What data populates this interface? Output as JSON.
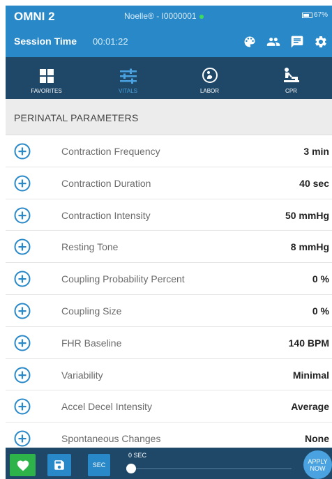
{
  "header": {
    "app_title": "OMNI 2",
    "device": "Noelle® - I0000001",
    "battery": "67%",
    "session_label": "Session Time",
    "session_time": "00:01:22"
  },
  "nav": {
    "tabs": [
      {
        "label": "FAVORITES",
        "icon": "grid-icon",
        "active": false
      },
      {
        "label": "VITALS",
        "icon": "sliders-icon",
        "active": true
      },
      {
        "label": "LABOR",
        "icon": "labor-icon",
        "active": false
      },
      {
        "label": "CPR",
        "icon": "cpr-icon",
        "active": false
      }
    ]
  },
  "section": {
    "title": "PERINATAL PARAMETERS"
  },
  "parameters": [
    {
      "label": "Contraction Frequency",
      "value": "3 min"
    },
    {
      "label": "Contraction Duration",
      "value": "40 sec"
    },
    {
      "label": "Contraction Intensity",
      "value": "50 mmHg"
    },
    {
      "label": "Resting Tone",
      "value": "8 mmHg"
    },
    {
      "label": "Coupling Probability Percent",
      "value": "0 %"
    },
    {
      "label": "Coupling Size",
      "value": "0 %"
    },
    {
      "label": "FHR Baseline",
      "value": "140 BPM"
    },
    {
      "label": "Variability",
      "value": "Minimal"
    },
    {
      "label": "Accel Decel Intensity",
      "value": "Average"
    },
    {
      "label": "Spontaneous Changes",
      "value": "None"
    }
  ],
  "bottom": {
    "sec_label": "SEC",
    "slider_value": "0 SEC",
    "slider_fraction": 0,
    "apply_line1": "APPLY",
    "apply_line2": "NOW"
  },
  "colors": {
    "header_blue": "#2989c8",
    "nav_dark": "#1f4868",
    "accent": "#4aa3e0",
    "green": "#2db34a"
  }
}
